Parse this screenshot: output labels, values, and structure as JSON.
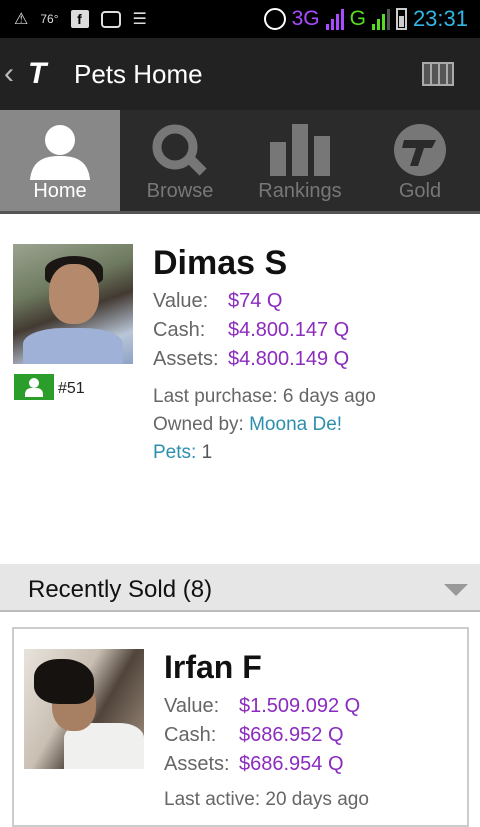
{
  "status_bar": {
    "temperature": "76°",
    "network": "3G",
    "network_secondary": "G",
    "time": "23:31",
    "icons": [
      "warning-icon",
      "facebook-icon",
      "bbm-icon",
      "settings-sliders-icon",
      "alarm-icon",
      "signal-icon",
      "battery-icon"
    ]
  },
  "action_bar": {
    "title": "Pets Home",
    "logo_text": "T",
    "back_glyph": "‹"
  },
  "tabs": [
    {
      "label": "Home",
      "icon": "person-icon",
      "active": true
    },
    {
      "label": "Browse",
      "icon": "magnifier-icon",
      "active": false
    },
    {
      "label": "Rankings",
      "icon": "bar-chart-icon",
      "active": false
    },
    {
      "label": "Gold",
      "icon": "gold-coin-icon",
      "active": false
    }
  ],
  "profile": {
    "name": "Dimas S",
    "rank": "#51",
    "value_label": "Value:",
    "value": "$74 Q",
    "cash_label": "Cash:",
    "cash": "$4.800.147 Q",
    "assets_label": "Assets:",
    "assets": "$4.800.149 Q",
    "last_purchase": "Last purchase: 6 days ago",
    "owned_by_label": "Owned by: ",
    "owned_by": "Moona De!",
    "pets_label": "Pets:",
    "pets_count": "1"
  },
  "recently_sold": {
    "header": "Recently Sold (8)",
    "items": [
      {
        "name": "Irfan F",
        "value_label": "Value:",
        "value": "$1.509.092 Q",
        "cash_label": "Cash:",
        "cash": "$686.952 Q",
        "assets_label": "Assets:",
        "assets": "$686.954 Q",
        "last_active": "Last active: 20 days ago"
      }
    ]
  },
  "colors": {
    "money": "#8b2bbf",
    "link": "#2d8fae",
    "rank_badge": "#2a9d2a",
    "clock": "#33b5e5"
  }
}
